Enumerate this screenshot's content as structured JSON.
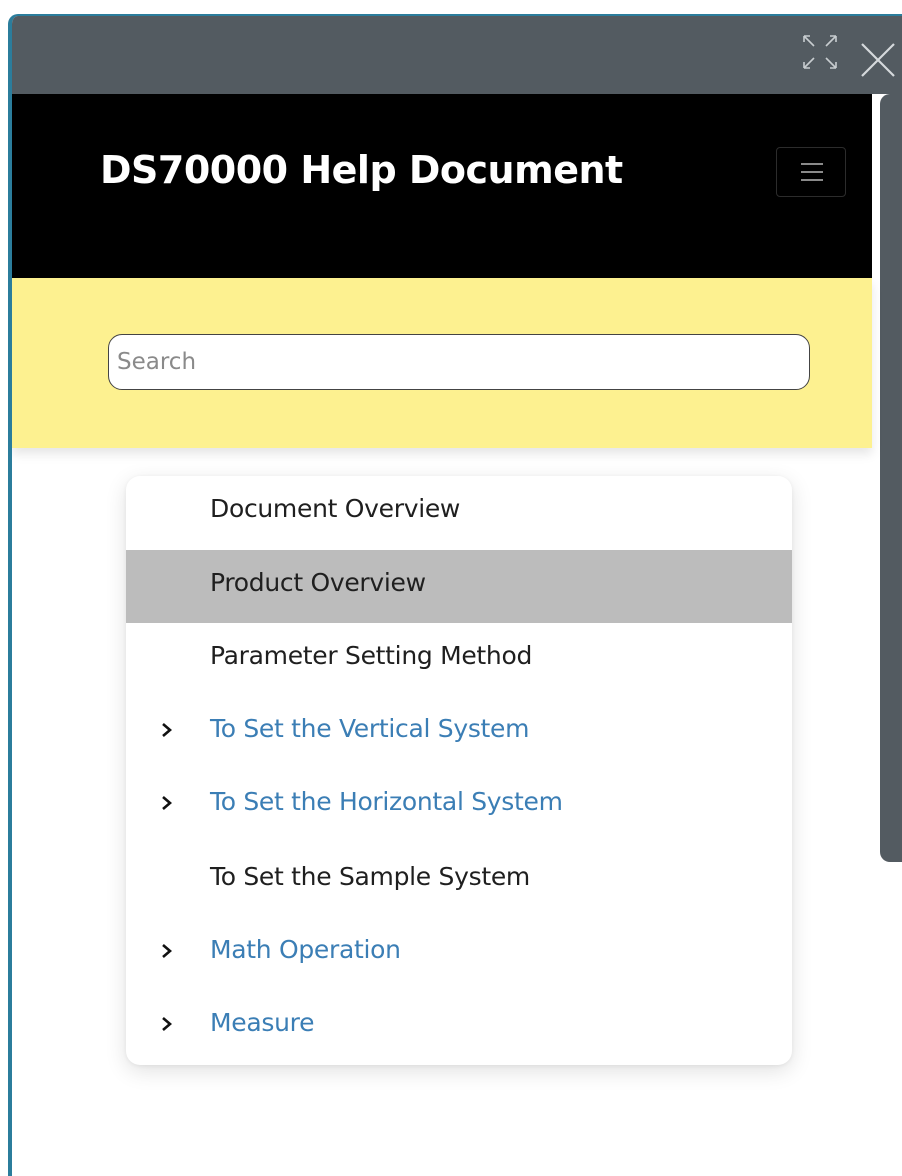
{
  "window": {
    "expand_icon": "expand-icon",
    "close_icon": "close-icon"
  },
  "header": {
    "title": "DS70000 Help Document",
    "menu_icon": "hamburger-menu-icon"
  },
  "search": {
    "placeholder": "Search",
    "value": ""
  },
  "toc": {
    "items": [
      {
        "label": "Document Overview",
        "expandable": false,
        "selected": false
      },
      {
        "label": "Product Overview",
        "expandable": false,
        "selected": true
      },
      {
        "label": "Parameter Setting Method",
        "expandable": false,
        "selected": false
      },
      {
        "label": "To Set the Vertical System",
        "expandable": true,
        "selected": false
      },
      {
        "label": "To Set the Horizontal System",
        "expandable": true,
        "selected": false
      },
      {
        "label": "To Set the Sample System",
        "expandable": false,
        "selected": false
      },
      {
        "label": "Math Operation",
        "expandable": true,
        "selected": false
      },
      {
        "label": "Measure",
        "expandable": true,
        "selected": false
      }
    ]
  },
  "colors": {
    "titlebar": "#535b61",
    "header_bg": "#000000",
    "search_band": "#fdf190",
    "link": "#3b7eb5",
    "selected_row": "#bcbcbc"
  }
}
